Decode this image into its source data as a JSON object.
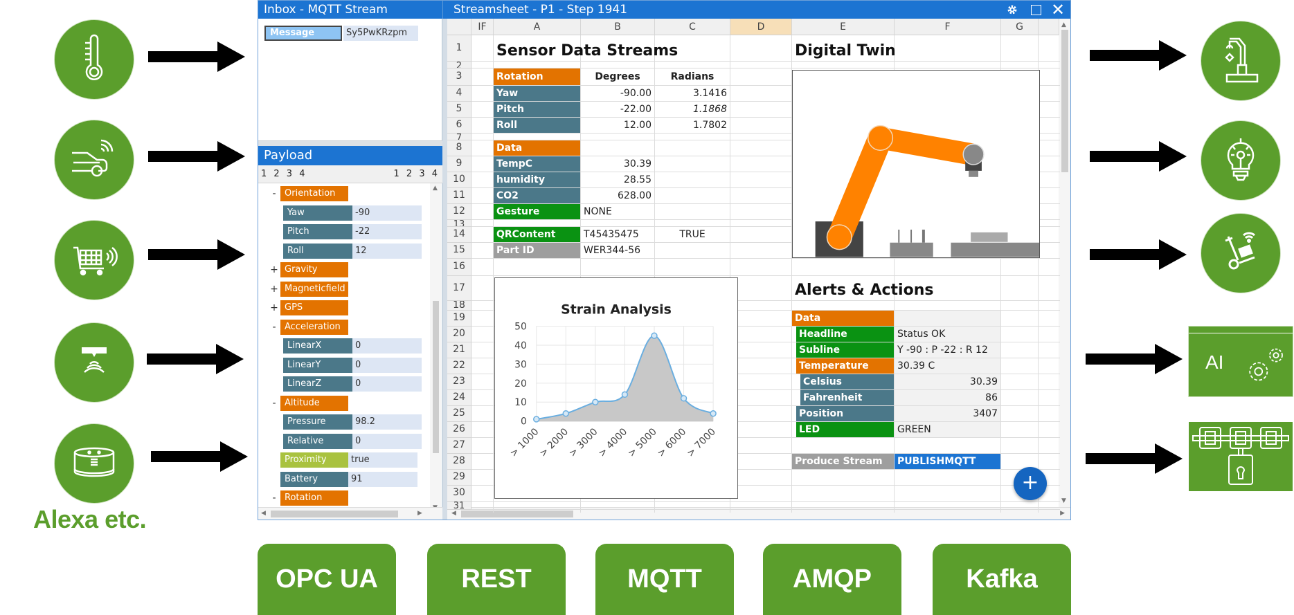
{
  "inputs_left": [
    {
      "icon": "thermometer-icon"
    },
    {
      "icon": "connected-car-icon"
    },
    {
      "icon": "smart-cart-icon"
    },
    {
      "icon": "proximity-sensor-icon"
    },
    {
      "icon": "smart-speaker-icon"
    }
  ],
  "alexa_label": "Alexa etc.",
  "outputs_right": [
    {
      "icon": "robot-arm-icon"
    },
    {
      "icon": "light-bulb-icon"
    },
    {
      "icon": "connected-hand-truck-icon"
    },
    {
      "icon": "ai-gears-icon",
      "label": "AI"
    },
    {
      "icon": "blockchain-lock-icon"
    }
  ],
  "protocols": [
    "OPC UA",
    "REST",
    "MQTT",
    "AMQP",
    "Kafka"
  ],
  "colors": {
    "brand_green": "#5b9e2c",
    "title_blue": "#1c74d2",
    "orange": "#e37300",
    "teal": "#4b7889",
    "green": "#0a9212",
    "grey": "#9e9e9e",
    "lime": "#a9c23f"
  },
  "inbox": {
    "title": "Inbox - MQTT Stream",
    "message_label": "Message",
    "message_value": "Sy5PwKRzpm",
    "payload_title": "Payload",
    "levels_left": "1 2 3 4",
    "levels_right": "1 2 3 4",
    "tree": [
      {
        "toggle": "-",
        "key": "Orientation",
        "value": null,
        "indent": 0,
        "kind": "orange"
      },
      {
        "toggle": "",
        "key": "Yaw",
        "value": "-90",
        "indent": 1,
        "kind": "teal"
      },
      {
        "toggle": "",
        "key": "Pitch",
        "value": "-22",
        "indent": 1,
        "kind": "teal"
      },
      {
        "toggle": "",
        "key": "Roll",
        "value": "12",
        "indent": 1,
        "kind": "teal"
      },
      {
        "toggle": "+",
        "key": "Gravity",
        "value": null,
        "indent": 0,
        "kind": "orange"
      },
      {
        "toggle": "+",
        "key": "Magneticfield",
        "value": null,
        "indent": 0,
        "kind": "orange"
      },
      {
        "toggle": "+",
        "key": "GPS",
        "value": null,
        "indent": 0,
        "kind": "orange"
      },
      {
        "toggle": "-",
        "key": "Acceleration",
        "value": null,
        "indent": 0,
        "kind": "orange"
      },
      {
        "toggle": "",
        "key": "LinearX",
        "value": "0",
        "indent": 1,
        "kind": "teal"
      },
      {
        "toggle": "",
        "key": "LinearY",
        "value": "0",
        "indent": 1,
        "kind": "teal"
      },
      {
        "toggle": "",
        "key": "LinearZ",
        "value": "0",
        "indent": 1,
        "kind": "teal"
      },
      {
        "toggle": "-",
        "key": "Altitude",
        "value": null,
        "indent": 0,
        "kind": "orange"
      },
      {
        "toggle": "",
        "key": "Pressure",
        "value": "98.2",
        "indent": 1,
        "kind": "teal"
      },
      {
        "toggle": "",
        "key": "Relative",
        "value": "0",
        "indent": 1,
        "kind": "teal"
      },
      {
        "toggle": "",
        "key": "Proximity",
        "value": "true",
        "indent": 0,
        "kind": "lime"
      },
      {
        "toggle": "",
        "key": "Battery",
        "value": "91",
        "indent": 0,
        "kind": "teal"
      },
      {
        "toggle": "-",
        "key": "Rotation",
        "value": null,
        "indent": 0,
        "kind": "orange"
      }
    ]
  },
  "sheet": {
    "title": "Streamsheet - P1 - Step 1941",
    "controls": {
      "settings": "gear-icon",
      "maximize": "maximize-icon",
      "close": "close-icon"
    },
    "columns": [
      "IF",
      "A",
      "B",
      "C",
      "D",
      "E",
      "F",
      "G"
    ],
    "selected_column": "D",
    "rows": [
      "1",
      "2",
      "3",
      "4",
      "5",
      "6",
      "7",
      "8",
      "9",
      "10",
      "11",
      "12",
      "13",
      "14",
      "15",
      "16",
      "17",
      "18",
      "19",
      "20",
      "21",
      "22",
      "23",
      "24",
      "25",
      "26",
      "27",
      "28",
      "29",
      "30",
      "31"
    ],
    "sensor_title": "Sensor Data Streams",
    "rotation": {
      "header": "Rotation",
      "col_b": "Degrees",
      "col_c": "Radians",
      "rows": [
        {
          "label": "Yaw",
          "degrees": "-90.00",
          "radians": "3.1416"
        },
        {
          "label": "Pitch",
          "degrees": "-22.00",
          "radians": "1.1868"
        },
        {
          "label": "Roll",
          "degrees": "12.00",
          "radians": "1.7802"
        }
      ]
    },
    "data": {
      "header": "Data",
      "rows": [
        {
          "label": "TempC",
          "value": "30.39"
        },
        {
          "label": "humidity",
          "value": "28.55"
        },
        {
          "label": "CO2",
          "value": "628.00"
        }
      ],
      "gesture_label": "Gesture",
      "gesture_value": "NONE",
      "qr_label": "QRContent",
      "qr_value": "T45435475",
      "qr_flag": "TRUE",
      "part_label": "Part ID",
      "part_value": "WER344-56"
    },
    "digital_twin_title": "Digital Twin",
    "alerts": {
      "title": "Alerts & Actions",
      "data_header": "Data",
      "rows": [
        {
          "label": "Headline",
          "value": "Status OK",
          "kind": "green",
          "align": "left",
          "indent": 1
        },
        {
          "label": "Subline",
          "value": "Y -90 : P -22 : R 12",
          "kind": "green",
          "align": "left",
          "indent": 1
        },
        {
          "label": "Temperature",
          "value": "30.39 C",
          "kind": "orange",
          "align": "left",
          "indent": 1
        },
        {
          "label": "Celsius",
          "value": "30.39",
          "kind": "teal",
          "align": "right",
          "indent": 2
        },
        {
          "label": "Fahrenheit",
          "value": "86",
          "kind": "teal",
          "align": "right",
          "indent": 2
        },
        {
          "label": "Position",
          "value": "3407",
          "kind": "teal",
          "align": "right",
          "indent": 1
        },
        {
          "label": "LED",
          "value": "GREEN",
          "kind": "green",
          "align": "left",
          "indent": 1
        }
      ],
      "produce_label": "Produce Stream",
      "produce_value": "PUBLISHMQTT"
    },
    "fab_label": "+"
  },
  "chart_data": {
    "type": "area",
    "title": "Strain Analysis",
    "categories": [
      "> 1000",
      "> 2000",
      "> 3000",
      "> 4000",
      "> 5000",
      "> 6000",
      "> 7000"
    ],
    "values": [
      1,
      4,
      10,
      14,
      45,
      12,
      4
    ],
    "ylim": [
      0,
      50
    ],
    "yticks": [
      0,
      10,
      20,
      30,
      40,
      50
    ],
    "xlabel": "",
    "ylabel": "",
    "grid": true,
    "legend": "none",
    "line_color": "#6aaee0",
    "fill_color": "#c8c8c8"
  }
}
